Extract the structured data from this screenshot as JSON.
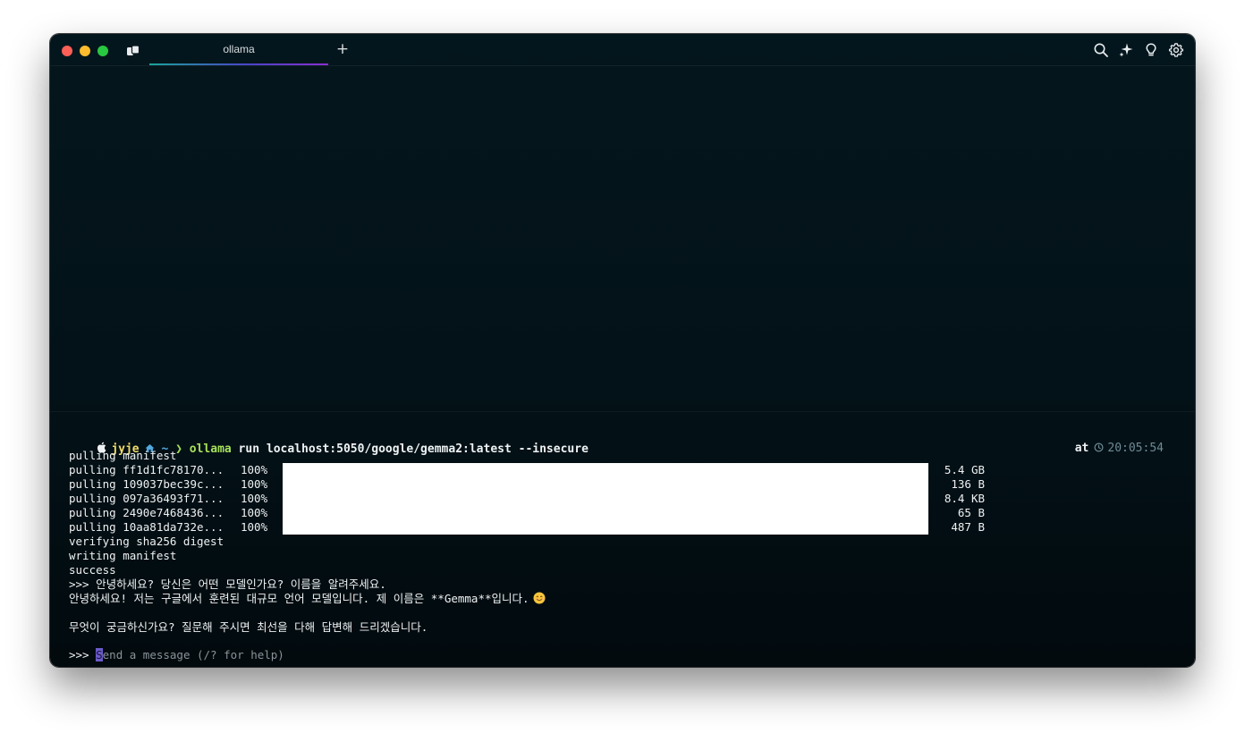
{
  "window": {
    "tab_title": "ollama",
    "new_tab_symbol": "+",
    "toolbar_icons": [
      "search-icon",
      "sparkle-ai-icon",
      "lightbulb-icon",
      "gear-icon"
    ]
  },
  "colors": {
    "background": "#03141a",
    "user": "#f3dc67",
    "path": "#52a7de",
    "command": "#a6e05a",
    "timestamp": "#6f8b96",
    "progress_fill": "#ffffff",
    "cursor": "#6a5bc8"
  },
  "prompt": {
    "user": "jyje",
    "path": "~",
    "chevron": "❯",
    "command": "ollama",
    "args": " run localhost:5050/google/gemma2:latest --insecure",
    "at_label": "at",
    "time": "20:05:54"
  },
  "output": {
    "pulling_manifest": "pulling manifest",
    "pull_rows": [
      {
        "label": "pulling ff1d1fc78170...",
        "percent": "100%",
        "progress": 1.0,
        "size": "5.4 GB"
      },
      {
        "label": "pulling 109037bec39c...",
        "percent": "100%",
        "progress": 1.0,
        "size": "136 B"
      },
      {
        "label": "pulling 097a36493f71...",
        "percent": "100%",
        "progress": 1.0,
        "size": "8.4 KB"
      },
      {
        "label": "pulling 2490e7468436...",
        "percent": "100%",
        "progress": 1.0,
        "size": "65 B"
      },
      {
        "label": "pulling 10aa81da732e...",
        "percent": "100%",
        "progress": 1.0,
        "size": "487 B"
      }
    ],
    "verifying": "verifying sha256 digest",
    "writing": "writing manifest",
    "success": "success",
    "user_message": ">>> 안녕하세요? 당신은 어떤 모델인가요? 이름을 알려주세요.",
    "reply_line1": "안녕하세요! 저는 구글에서 훈련된 대규모 언어 모델입니다. 제 이름은 **Gemma**입니다.",
    "reply_line2": "무엇이 궁금하신가요? 질문해 주시면 최선을 다해 답변해 드리겠습니다."
  },
  "input": {
    "prompt": ">>> ",
    "cursor_char": "S",
    "placeholder_rest": "end a message (/? for help)"
  }
}
